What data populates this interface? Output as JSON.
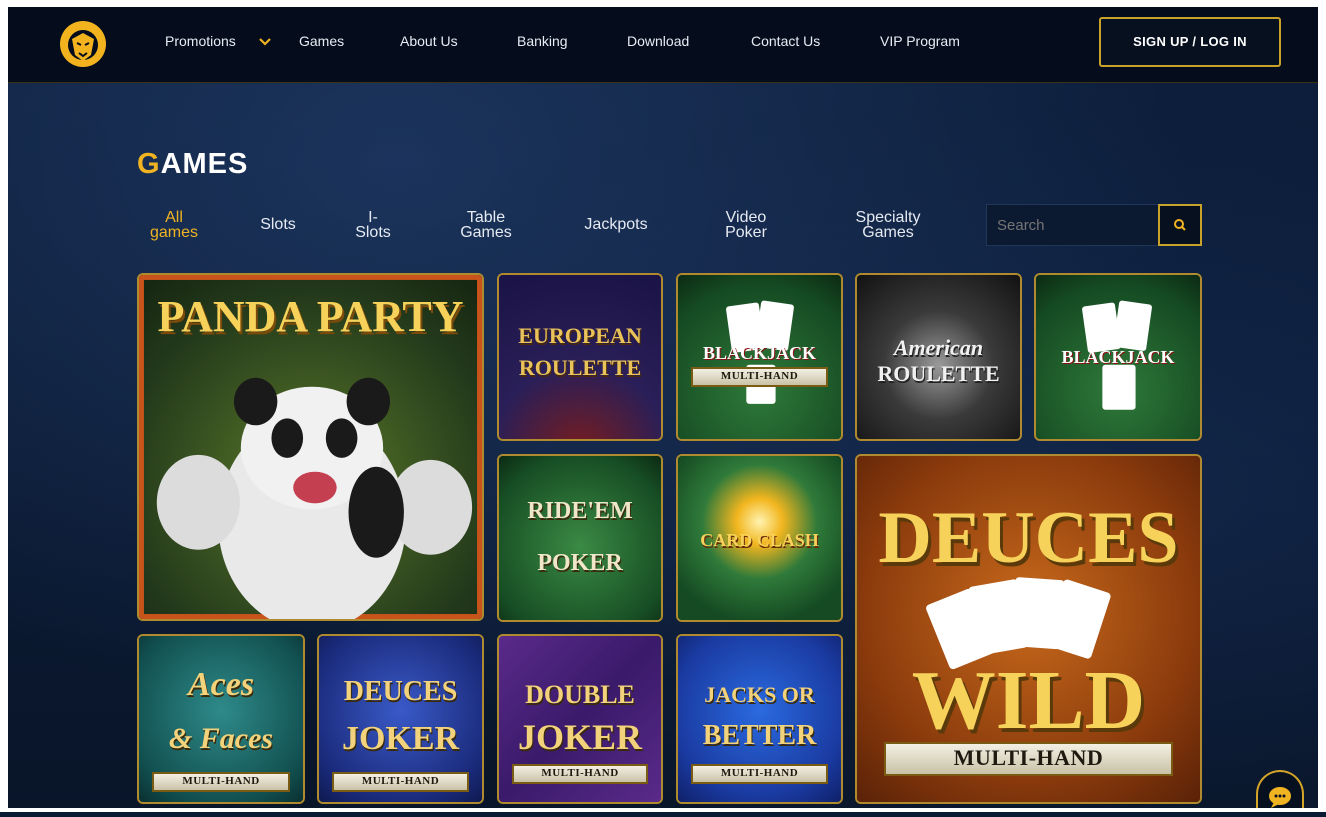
{
  "nav": {
    "items": [
      {
        "label": "Promotions",
        "has_dropdown": true
      },
      {
        "label": "Games"
      },
      {
        "label": "About Us"
      },
      {
        "label": "Banking"
      },
      {
        "label": "Download"
      },
      {
        "label": "Contact Us"
      },
      {
        "label": "VIP Program"
      }
    ],
    "signup_label": "SIGN UP / LOG IN"
  },
  "section": {
    "title_first": "G",
    "title_rest": "AMES"
  },
  "tabs": [
    {
      "line1": "All",
      "line2": "games",
      "active": true
    },
    {
      "line1": "Slots",
      "line2": ""
    },
    {
      "line1": "I-",
      "line2": "Slots"
    },
    {
      "line1": "Table",
      "line2": "Games"
    },
    {
      "line1": "Jackpots",
      "line2": ""
    },
    {
      "line1": "Video",
      "line2": "Poker"
    },
    {
      "line1": "Specialty",
      "line2": "Games"
    }
  ],
  "search": {
    "placeholder": "Search"
  },
  "games": [
    {
      "title_line1": "PANDA PARTY",
      "title_line2": "",
      "ribbon": ""
    },
    {
      "title_line1": "EUROPEAN",
      "title_line2": "ROULETTE",
      "ribbon": ""
    },
    {
      "title_line1": "BLACKJACK",
      "title_line2": "",
      "ribbon": "MULTI-HAND"
    },
    {
      "title_line1": "American",
      "title_line2": "ROULETTE",
      "ribbon": ""
    },
    {
      "title_line1": "BLACKJACK",
      "title_line2": "",
      "ribbon": ""
    },
    {
      "title_line1": "RIDE'EM",
      "title_line2": "POKER",
      "ribbon": ""
    },
    {
      "title_line1": "CARD CLASH",
      "title_line2": "",
      "ribbon": ""
    },
    {
      "title_line1": "DEUCES",
      "title_line2": "WILD",
      "ribbon": "MULTI-HAND"
    },
    {
      "title_line1": "Aces",
      "title_line2": "& Faces",
      "ribbon": "MULTI-HAND"
    },
    {
      "title_line1": "DEUCES",
      "title_line2": "JOKER",
      "ribbon": "MULTI-HAND"
    },
    {
      "title_line1": "DOUBLE",
      "title_line2": "JOKER",
      "ribbon": "MULTI-HAND"
    },
    {
      "title_line1": "JACKS OR",
      "title_line2": "BETTER",
      "ribbon": "MULTI-HAND"
    }
  ],
  "colors": {
    "accent": "#f0b321",
    "border": "#b08a2e",
    "bg": "#0b1a33"
  }
}
